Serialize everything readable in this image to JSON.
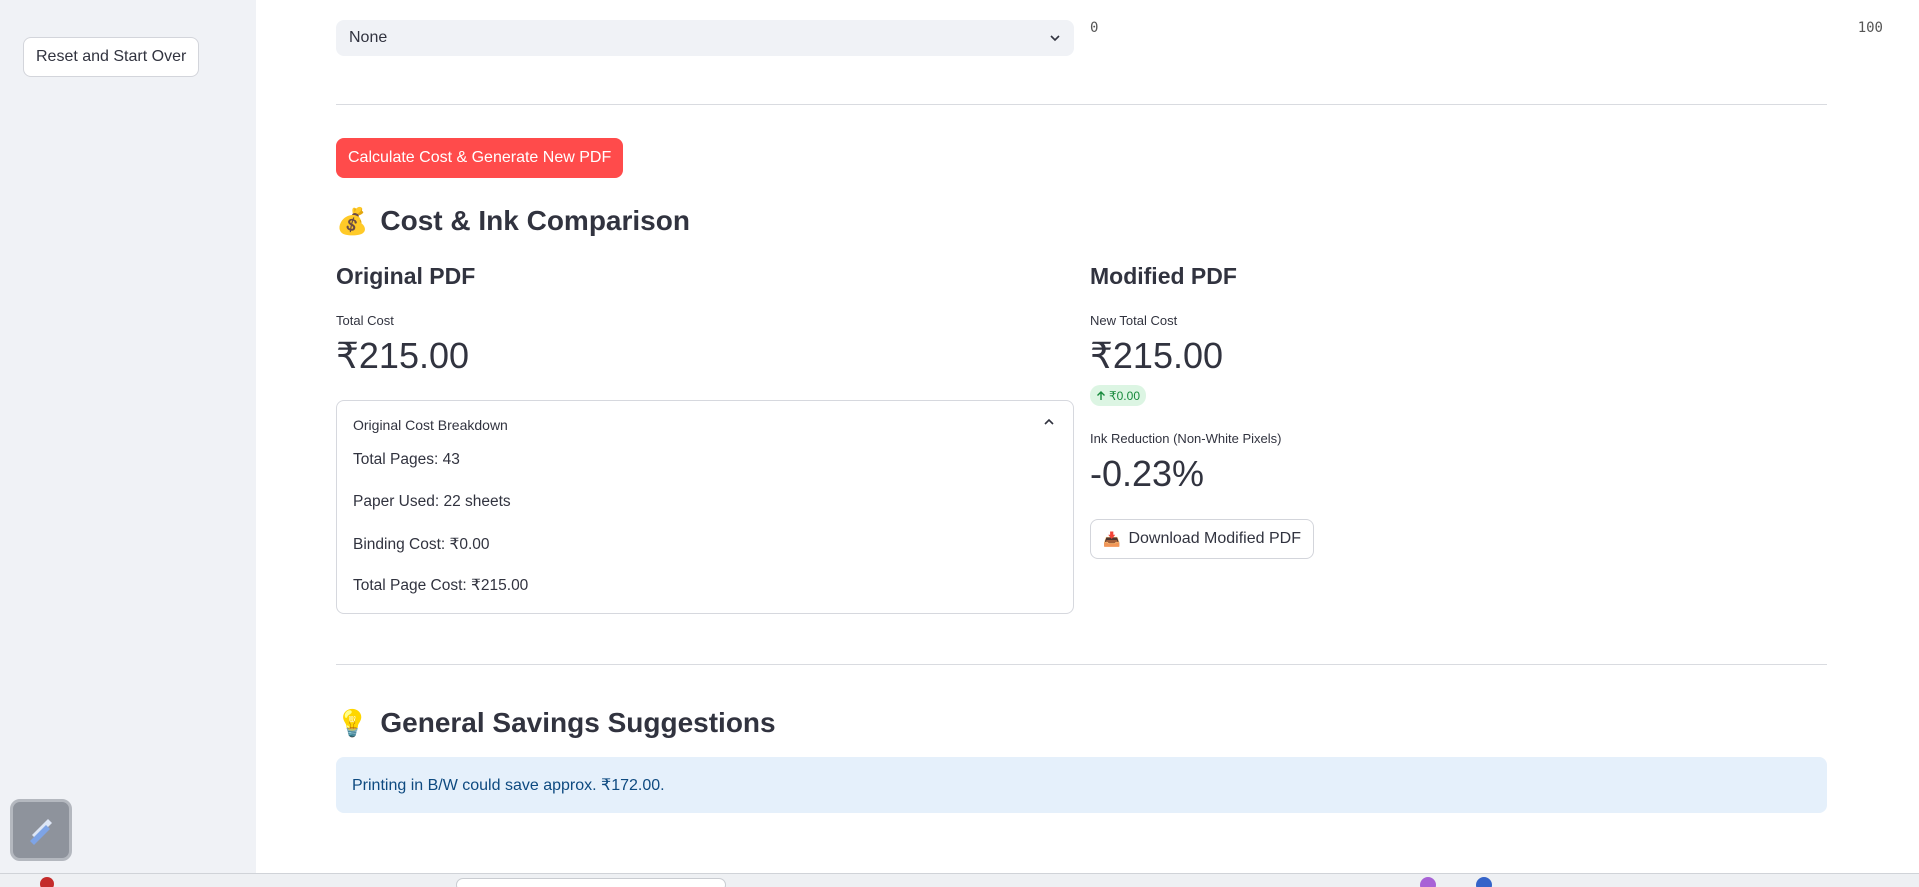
{
  "sidebar": {
    "reset_label": "Reset and Start Over"
  },
  "controls": {
    "select_value": "None",
    "slider_min": "0",
    "slider_max": "100",
    "calculate_label": "Calculate Cost & Generate New PDF"
  },
  "comparison": {
    "emoji": "💰",
    "title": "Cost & Ink Comparison",
    "original": {
      "title": "Original PDF",
      "cost_label": "Total Cost",
      "cost_value": "₹215.00",
      "breakdown": {
        "header": "Original Cost Breakdown",
        "lines": [
          "Total Pages: 43",
          "Paper Used: 22 sheets",
          "Binding Cost: ₹0.00",
          "Total Page Cost: ₹215.00"
        ]
      }
    },
    "modified": {
      "title": "Modified PDF",
      "cost_label": "New Total Cost",
      "cost_value": "₹215.00",
      "delta": "₹0.00",
      "ink_label": "Ink Reduction (Non-White Pixels)",
      "ink_value": "-0.23%",
      "download_label": "Download Modified PDF",
      "download_icon": "📥"
    }
  },
  "suggestions": {
    "emoji": "💡",
    "title": "General Savings Suggestions",
    "message": "Printing in B/W could save approx. ₹172.00."
  },
  "colors": {
    "primary": "#ff4b4b",
    "info_bg": "#e5f0fb",
    "info_text": "#0e4a80",
    "delta_positive": "#178a3c"
  }
}
